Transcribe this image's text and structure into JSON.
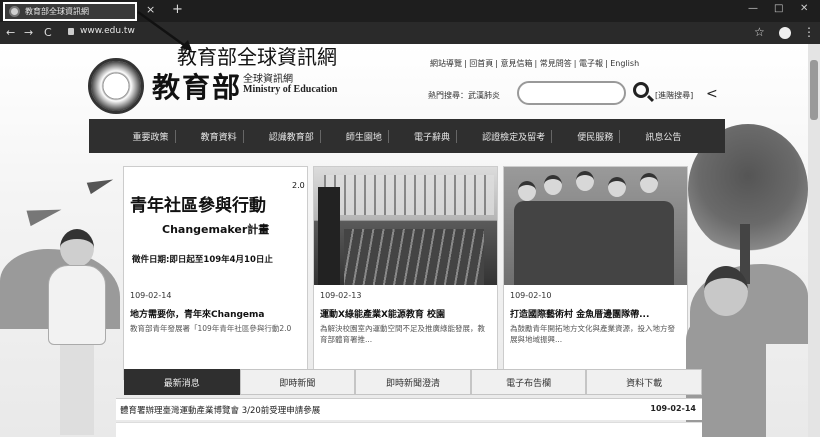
{
  "browser": {
    "tab_title": "教育部全球資訊網",
    "tab_close": "×",
    "tab_new": "+",
    "win_min": "—",
    "win_max": "□",
    "win_close": "✕",
    "back": "←",
    "forward": "→",
    "reload": "C",
    "url": "www.edu.tw",
    "star": "☆",
    "menu": "⋮"
  },
  "annotation": {
    "label": "教育部全球資訊網"
  },
  "header": {
    "logo_zh": "教育部",
    "logo_sub1": "全球資訊網",
    "logo_sub2": "Ministry of Education",
    "top_links": [
      "網站導覽",
      "回首頁",
      "意見信箱",
      "常見問答",
      "電子報",
      "English"
    ],
    "hot_search": "熱門搜尋：武漢肺炎",
    "search_placeholder": "",
    "advanced": "[進階搜尋]",
    "share": "<"
  },
  "menu": {
    "items": [
      "重要政策",
      "教育資料",
      "認識教育部",
      "師生園地",
      "電子辭典",
      "認證檢定及留考",
      "便民服務",
      "訊息公告"
    ]
  },
  "cards": [
    {
      "date": "109-02-14",
      "title": "地方需要你，青年來Changema",
      "desc": "教育部青年發展署「109年青年社區參與行動2.0",
      "img_big": "青年社區參與行動",
      "img_sup": "2.0",
      "img_cm": "Changemaker計畫",
      "img_deadline": "徵件日期:即日起至109年4月10日止"
    },
    {
      "date": "109-02-13",
      "title": "運動X綠能產業X能源教育 校園",
      "desc": "為解決校園室內運動空間不足及推廣綠能發展，教育部體育署推..."
    },
    {
      "date": "109-02-10",
      "title": "打造國際藝術村 金魚厝邊團隊帶...",
      "desc": "為鼓勵青年開拓地方文化與產業資源，投入地方發展與地域振興..."
    }
  ],
  "tabs": [
    "最新消息",
    "即時新聞",
    "即時新聞澄清",
    "電子布告欄",
    "資料下載"
  ],
  "news": [
    {
      "title": "體育署辦理臺灣運動產業博覽會 3/20前受理申請參展",
      "date": "109-02-14"
    }
  ]
}
